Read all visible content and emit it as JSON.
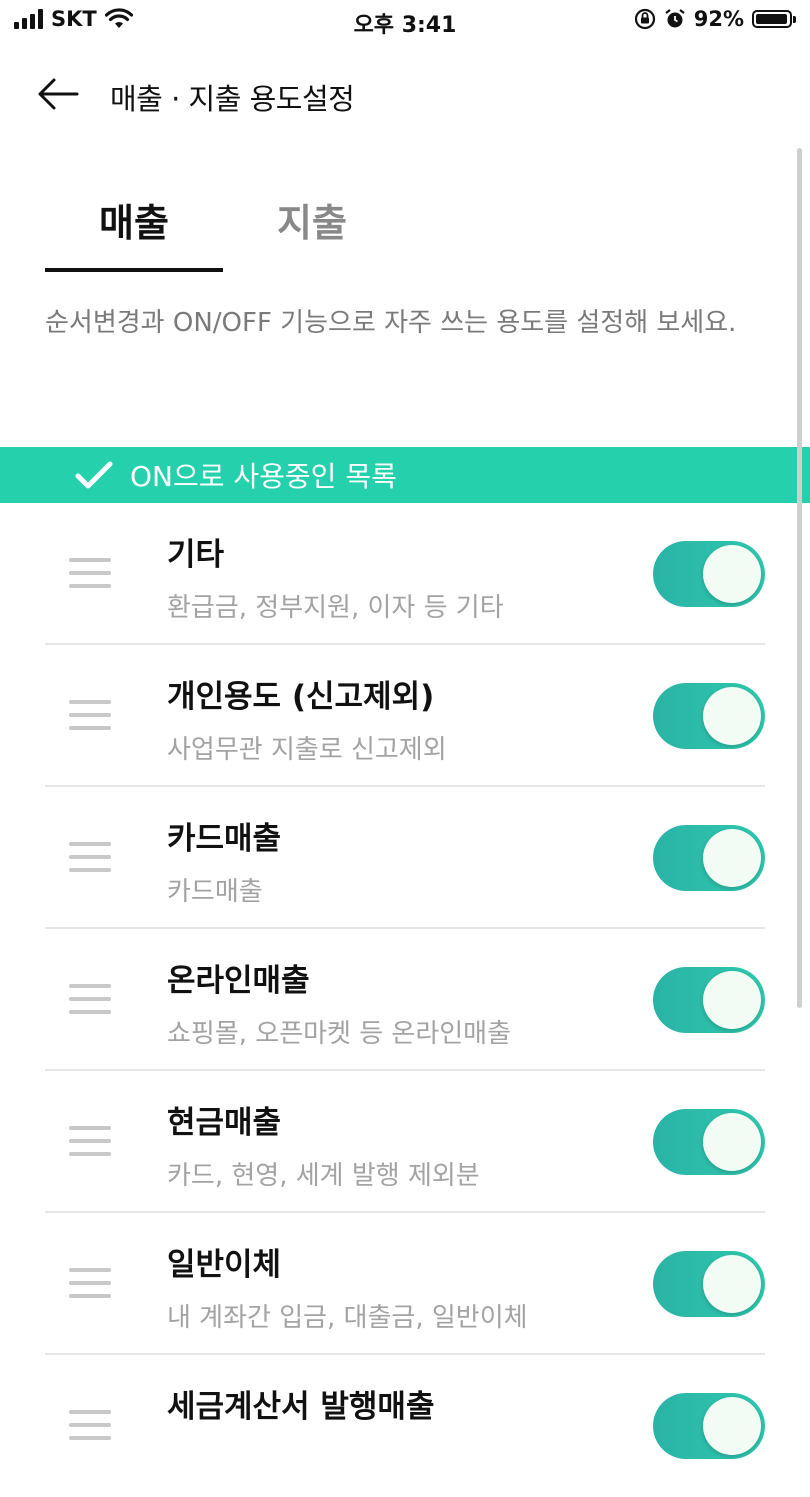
{
  "status_bar": {
    "carrier": "SKT",
    "time": "오후 3:41",
    "battery": "92%",
    "icons": [
      "signal-icon",
      "wifi-icon",
      "orientation-lock-icon",
      "alarm-icon",
      "battery-icon"
    ]
  },
  "header": {
    "back_icon": "back-arrow-icon",
    "title": "매출 · 지출 용도설정"
  },
  "tabs": [
    {
      "label": "매출",
      "selected": true
    },
    {
      "label": "지출",
      "selected": false
    }
  ],
  "description": "순서변경과 ON/OFF 기능으로 자주 쓰는 용도를 설정해 보세요.",
  "section": {
    "icon": "check-icon",
    "label": "ON으로 사용중인 목록",
    "color": "#25d1ad"
  },
  "items": [
    {
      "title": "기타",
      "subtitle": "환급금, 정부지원, 이자 등 기타",
      "on": true
    },
    {
      "title": "개인용도 (신고제외)",
      "subtitle": "사업무관 지출로 신고제외",
      "on": true
    },
    {
      "title": "카드매출",
      "subtitle": "카드매출",
      "on": true
    },
    {
      "title": "온라인매출",
      "subtitle": "쇼핑몰, 오픈마켓 등 온라인매출",
      "on": true
    },
    {
      "title": "현금매출",
      "subtitle": "카드, 현영, 세계 발행 제외분",
      "on": true
    },
    {
      "title": "일반이체",
      "subtitle": "내 계좌간 입금, 대출금, 일반이체",
      "on": true
    },
    {
      "title": "세금계산서 발행매출",
      "subtitle": "",
      "on": true
    }
  ],
  "colors": {
    "accent": "#25d1ad",
    "toggle_on": "#2ab3a6",
    "text_primary": "#111111",
    "text_secondary": "#a3a3a3"
  }
}
